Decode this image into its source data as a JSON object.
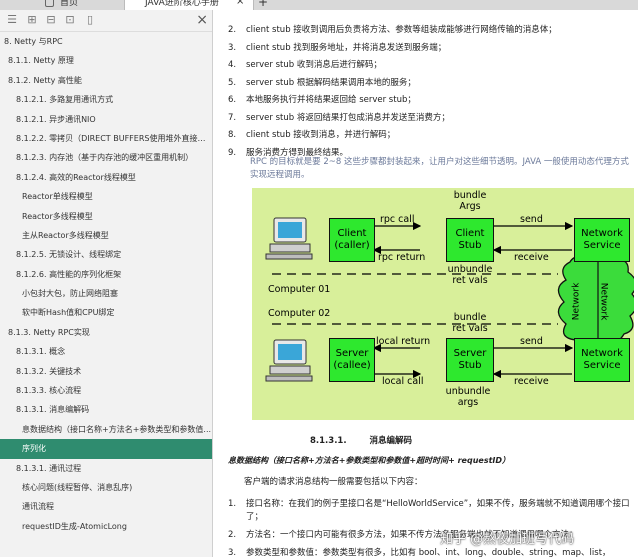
{
  "tabs": {
    "home": "首页",
    "doc": "JAVA进阶核心手册"
  },
  "sidebar": {
    "items": [
      {
        "label": "8. Netty 与RPC",
        "level": 1
      },
      {
        "label": "8.1.1. Netty 原理",
        "level": 2
      },
      {
        "label": "8.1.2. Netty 高性能",
        "level": 2
      },
      {
        "label": "8.1.2.1. 多路复用通讯方式",
        "level": 3
      },
      {
        "label": "8.1.2.1. 异步通讯NIO",
        "level": 3
      },
      {
        "label": "8.1.2.2. 零拷贝（DIRECT BUFFERS使用堆外直接内...",
        "level": 3
      },
      {
        "label": "8.1.2.3. 内存池（基于内存池的缓冲区重用机制）",
        "level": 3
      },
      {
        "label": "8.1.2.4. 高效的Reactor线程模型",
        "level": 3
      },
      {
        "label": "Reactor单线程模型",
        "level": 4
      },
      {
        "label": "Reactor多线程模型",
        "level": 4
      },
      {
        "label": "主从Reactor多线程模型",
        "level": 4
      },
      {
        "label": "8.1.2.5. 无锁设计、线程绑定",
        "level": 3
      },
      {
        "label": "8.1.2.6. 高性能的序列化框架",
        "level": 3
      },
      {
        "label": "小包封大包，防止网络阻塞",
        "level": 4
      },
      {
        "label": "软中断Hash值和CPU绑定",
        "level": 4
      },
      {
        "label": "8.1.3. Netty RPC实现",
        "level": 2
      },
      {
        "label": "8.1.3.1. 概念",
        "level": 3
      },
      {
        "label": "8.1.3.2. 关键技术",
        "level": 3
      },
      {
        "label": "8.1.3.3. 核心流程",
        "level": 3
      },
      {
        "label": "8.1.3.1. 消息编解码",
        "level": 3
      },
      {
        "label": "息数据结构（接口名称+方法名+参数类型和参数值...",
        "level": 4
      },
      {
        "label": "序列化",
        "level": 4,
        "active": true
      },
      {
        "label": "8.1.3.1. 通讯过程",
        "level": 3
      },
      {
        "label": "核心问题(线程暂停、消息乱序)",
        "level": 4
      },
      {
        "label": "通讯流程",
        "level": 4
      },
      {
        "label": "requestID生成-AtomicLong",
        "level": 4
      }
    ]
  },
  "content": {
    "steps": [
      {
        "num": "2.",
        "text": "client stub 接收到调用后负责将方法、参数等组装成能够进行网络传输的消息体；"
      },
      {
        "num": "3.",
        "text": "client stub 找到服务地址，并将消息发送到服务端；"
      },
      {
        "num": "4.",
        "text": "server stub 收到消息后进行解码；"
      },
      {
        "num": "5.",
        "text": "server stub 根据解码结果调用本地的服务；"
      },
      {
        "num": "6.",
        "text": "本地服务执行并将结果返回给 server stub；"
      },
      {
        "num": "7.",
        "text": "server stub 将返回结果打包成消息并发送至消费方；"
      },
      {
        "num": "8.",
        "text": "client stub 接收到消息，并进行解码；"
      },
      {
        "num": "9.",
        "text": "服务消费方得到最终结果。"
      }
    ],
    "rpc_note": "RPC 的目标就是要 2~8 这些步骤都封装起来，让用户对这些细节透明。JAVA 一般使用动态代理方式实现远程调用。",
    "section_num": "8.1.3.1.",
    "section_title": "消息编解码",
    "schema_line": "息数据结构（接口名称+方法名+参数类型和参数值+超时时间+ requestID）",
    "intro": "客户端的请求消息结构一般需要包括以下内容：",
    "items": [
      {
        "num": "1.",
        "text": "接口名称：在我们的例子里接口名是“HelloWorldService”，如果不传，服务端就不知道调用哪个接口了；"
      },
      {
        "num": "2.",
        "text": "方法名：一个接口内可能有很多方法，如果不传方法名服务端也就不知道调用哪个方法；"
      },
      {
        "num": "3.",
        "text": "参数类型和参数值：参数类型有很多，比如有 bool、int、long、double、string、map、list，"
      }
    ],
    "watermark": "知乎 @熬夜加班写代码"
  },
  "diagram": {
    "client_box": "Client\n(caller)",
    "client_stub": "Client\nStub",
    "network_service_top": "Network\nService",
    "server_box": "Server\n(callee)",
    "server_stub": "Server\nStub",
    "network_service_bottom": "Network\nService",
    "rpc_call": "rpc call",
    "rpc_return": "rpc return",
    "bundle_args": "bundle\nArgs",
    "unbundle_ret": "unbundle\nret vals",
    "send_top": "send",
    "receive_top": "receive",
    "computer01": "Computer 01",
    "computer02": "Computer 02",
    "bundle_ret": "bundle\nret vals",
    "unbundle_args": "unbundle\nargs",
    "local_return": "local return",
    "local_call": "local call",
    "send_bottom": "send",
    "receive_bottom": "receive",
    "network_left": "Network",
    "network_right": "Network",
    "colors": {
      "box": "#2ee82e",
      "background": "#d8ef9a",
      "cloud": "#3bdc3b"
    }
  }
}
